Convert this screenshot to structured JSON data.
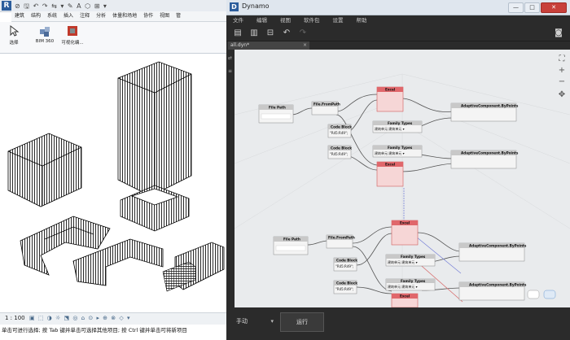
{
  "revit": {
    "menu_tabs": [
      "建筑",
      "结构",
      "系统",
      "插入",
      "注释",
      "分析",
      "体量和场地",
      "协作",
      "视图",
      "管"
    ],
    "tools": [
      {
        "label": "选择"
      },
      {
        "label": "BIM 360"
      },
      {
        "label": "可视化编..."
      }
    ],
    "status": {
      "scale": "1 : 100"
    },
    "hint": "单击可进行选择; 按 Tab 键并单击可选择其他项目; 按 Ctrl 键并单击可将新项目"
  },
  "dynamo": {
    "title": "Dynamo",
    "window_buttons": {
      "minimize": "—",
      "maximize": "□",
      "close": "✕"
    },
    "menu": [
      "文件",
      "编辑",
      "视图",
      "软件包",
      "设置",
      "帮助"
    ],
    "tab": {
      "name": "all.dyn*",
      "close": "×"
    },
    "bottom": {
      "run_mode": "手动",
      "run_button": "运行"
    },
    "zoom": {
      "fit": "⛶",
      "in": "+",
      "out": "−",
      "pan": "✥"
    },
    "nodes": {
      "file_path": "File Path",
      "file_from_path": "File.FromPath",
      "code_block": "Code Block",
      "family_types": "Family Types",
      "adaptive_by_points": "AdaptiveComponent.ByPoints",
      "excel_read": "Excel",
      "code_value": "\"R45:R49\";",
      "family_value": "建筑单元:建筑单元 ▾"
    },
    "accent": "#e0676b",
    "node_header": "#c8c8c8"
  }
}
